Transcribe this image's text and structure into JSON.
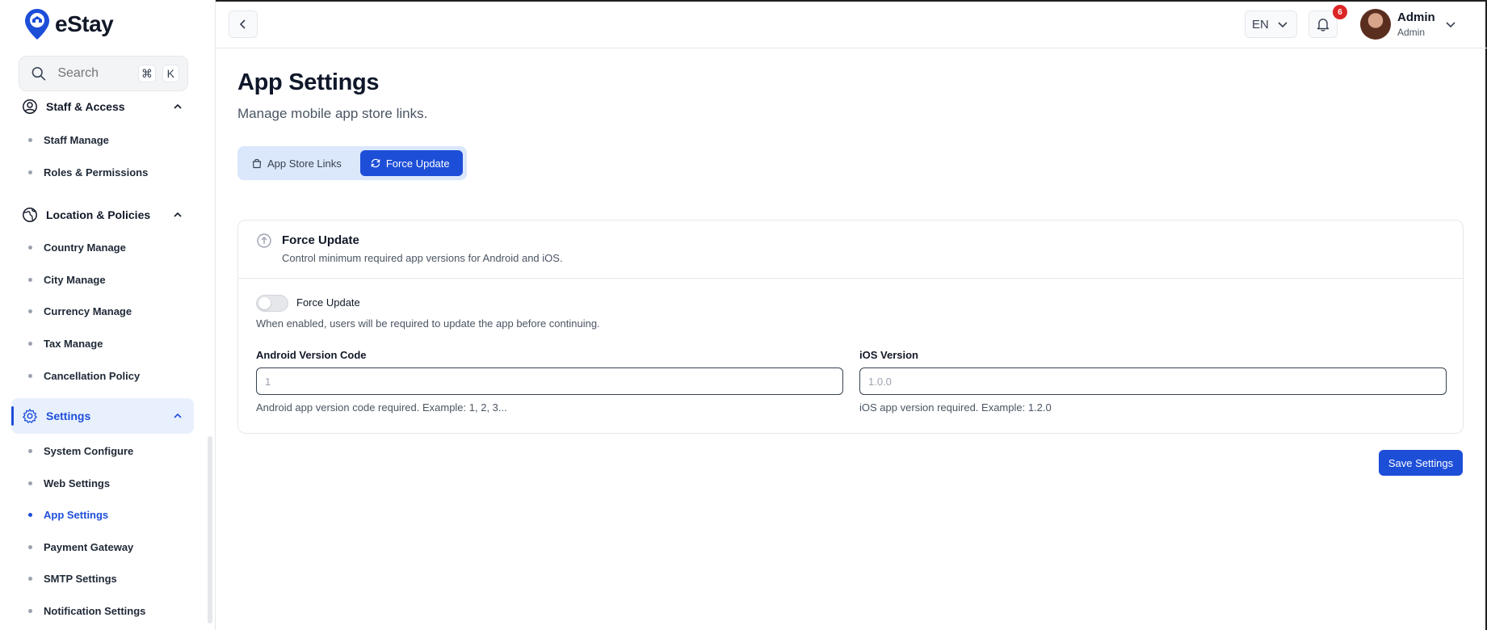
{
  "brand": {
    "name": "eStay"
  },
  "search": {
    "placeholder": "Search",
    "shortcut_mod": "⌘",
    "shortcut_key": "K"
  },
  "sidebar": {
    "groups": [
      {
        "label": "Staff & Access",
        "items": [
          "Staff Manage",
          "Roles & Permissions"
        ]
      },
      {
        "label": "Location & Policies",
        "items": [
          "Country Manage",
          "City Manage",
          "Currency Manage",
          "Tax Manage",
          "Cancellation Policy"
        ]
      },
      {
        "label": "Settings",
        "items": [
          "System Configure",
          "Web Settings",
          "App Settings",
          "Payment Gateway",
          "SMTP Settings",
          "Notification Settings"
        ]
      }
    ]
  },
  "header": {
    "language": "EN",
    "notification_count": "6",
    "user_name": "Admin",
    "user_role": "Admin"
  },
  "page": {
    "title": "App Settings",
    "subtitle": "Manage mobile app store links."
  },
  "tabs": [
    {
      "label": "App Store Links",
      "active": false
    },
    {
      "label": "Force Update",
      "active": true
    }
  ],
  "card": {
    "title": "Force Update",
    "description": "Control minimum required app versions for Android and iOS.",
    "toggle_label": "Force Update",
    "toggle_on": false,
    "toggle_help": "When enabled, users will be required to update the app before continuing.",
    "android": {
      "label": "Android Version Code",
      "value": "",
      "placeholder": "1",
      "help": "Android app version code required. Example: 1, 2, 3..."
    },
    "ios": {
      "label": "iOS Version",
      "value": "",
      "placeholder": "1.0.0",
      "help": "iOS app version required. Example: 1.2.0"
    }
  },
  "actions": {
    "save_label": "Save Settings"
  },
  "colors": {
    "accent": "#1d4ed8",
    "badge": "#dc2626"
  }
}
